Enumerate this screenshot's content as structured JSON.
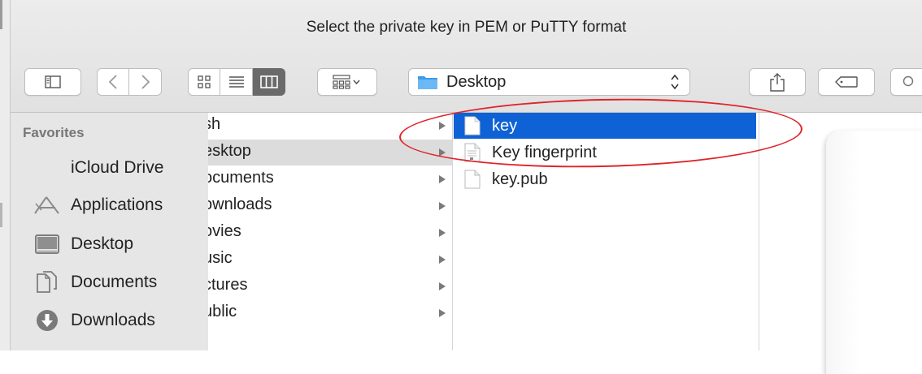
{
  "dialog": {
    "title": "Select the private key in PEM or PuTTY format"
  },
  "toolbar": {
    "location": "Desktop",
    "icons": [
      "sidebar-toggle-icon",
      "back-icon",
      "forward-icon",
      "icon-view-icon",
      "list-view-icon",
      "column-view-icon",
      "group-by-icon",
      "share-icon",
      "tag-icon",
      "search-icon"
    ]
  },
  "sidebar": {
    "heading": "Favorites",
    "items": [
      {
        "label": "iCloud Drive",
        "icon": "none"
      },
      {
        "label": "Applications",
        "icon": "applications-icon"
      },
      {
        "label": "Desktop",
        "icon": "desktop-icon"
      },
      {
        "label": "Documents",
        "icon": "documents-icon"
      },
      {
        "label": "Downloads",
        "icon": "downloads-icon"
      }
    ]
  },
  "column1": {
    "items": [
      {
        "label": "sh",
        "selected": false
      },
      {
        "label": "esktop",
        "selected": true
      },
      {
        "label": "ocuments",
        "selected": false
      },
      {
        "label": "ownloads",
        "selected": false
      },
      {
        "label": "ovies",
        "selected": false
      },
      {
        "label": "usic",
        "selected": false
      },
      {
        "label": "ctures",
        "selected": false
      },
      {
        "label": "ublic",
        "selected": false
      }
    ]
  },
  "column2": {
    "items": [
      {
        "label": "key",
        "selected": true
      },
      {
        "label": "Key fingerprint",
        "selected": false
      },
      {
        "label": "key.pub",
        "selected": false
      }
    ]
  },
  "colors": {
    "selection": "#0e62d6",
    "annotation": "#e0242b"
  }
}
